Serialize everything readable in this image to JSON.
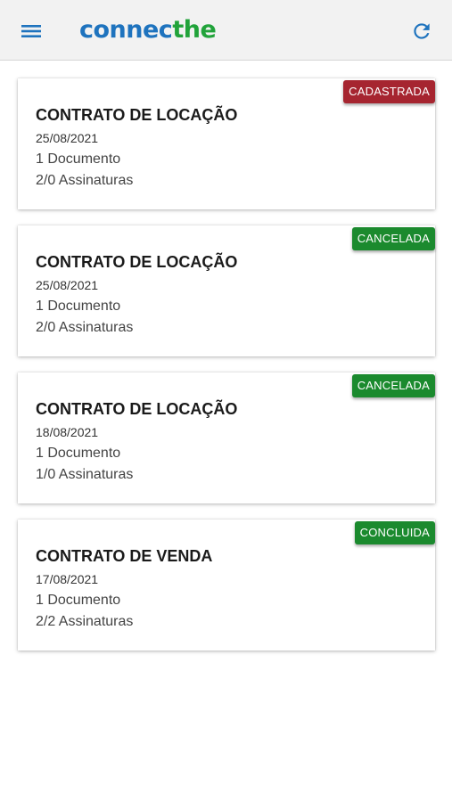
{
  "app": {
    "logo_part1": "connec",
    "logo_part2": "the",
    "colors": {
      "brand_blue": "#1e73be",
      "brand_green": "#21a33a"
    },
    "icons": {
      "menu": "menu-icon",
      "refresh": "refresh-icon"
    }
  },
  "cards": [
    {
      "title": "CONTRATO DE LOCAÇÃO",
      "date": "25/08/2021",
      "documents": "1 Documento",
      "signatures": "2/0 Assinaturas",
      "status": "CADASTRADA",
      "status_color": "#a62530"
    },
    {
      "title": "CONTRATO DE LOCAÇÃO",
      "date": "25/08/2021",
      "documents": "1 Documento",
      "signatures": "2/0 Assinaturas",
      "status": "CANCELADA",
      "status_color": "#1b8a2e"
    },
    {
      "title": "CONTRATO DE LOCAÇÃO",
      "date": "18/08/2021",
      "documents": "1 Documento",
      "signatures": "1/0 Assinaturas",
      "status": "CANCELADA",
      "status_color": "#1b8a2e"
    },
    {
      "title": "CONTRATO DE VENDA",
      "date": "17/08/2021",
      "documents": "1 Documento",
      "signatures": "2/2 Assinaturas",
      "status": "CONCLUIDA",
      "status_color": "#1b8a2e"
    }
  ]
}
